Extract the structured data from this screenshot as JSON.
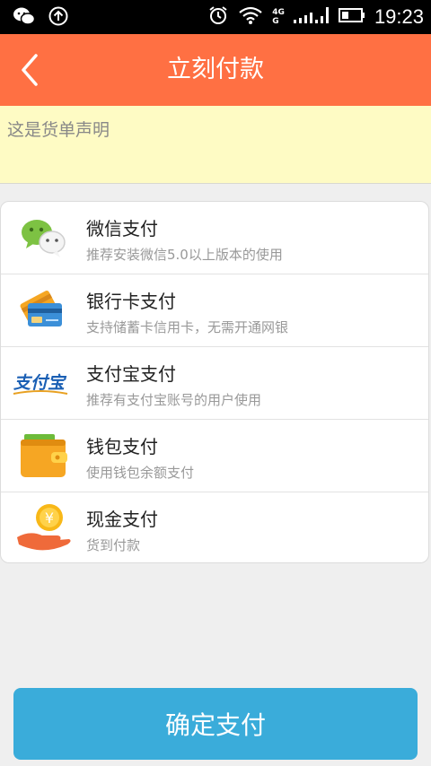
{
  "status_bar": {
    "time": "19:23",
    "network": [
      "4G",
      "G"
    ]
  },
  "header": {
    "title": "立刻付款"
  },
  "notice": {
    "text": "这是货单声明"
  },
  "payment_methods": [
    {
      "title": "微信支付",
      "desc": "推荐安装微信5.0以上版本的使用",
      "icon": "wechat-icon"
    },
    {
      "title": "银行卡支付",
      "desc": "支持储蓄卡信用卡，无需开通网银",
      "icon": "bank-card-icon"
    },
    {
      "title": "支付宝支付",
      "desc": "推荐有支付宝账号的用户使用",
      "icon": "alipay-icon",
      "logo_text": "支付宝"
    },
    {
      "title": "钱包支付",
      "desc": "使用钱包余额支付",
      "icon": "wallet-icon"
    },
    {
      "title": "现金支付",
      "desc": "货到付款",
      "icon": "cash-icon",
      "coin_symbol": "¥"
    }
  ],
  "confirm_button": {
    "label": "确定支付"
  },
  "colors": {
    "header": "#ff7043",
    "notice_bg": "#fefbc4",
    "confirm": "#3aacda",
    "background": "#efefef"
  }
}
